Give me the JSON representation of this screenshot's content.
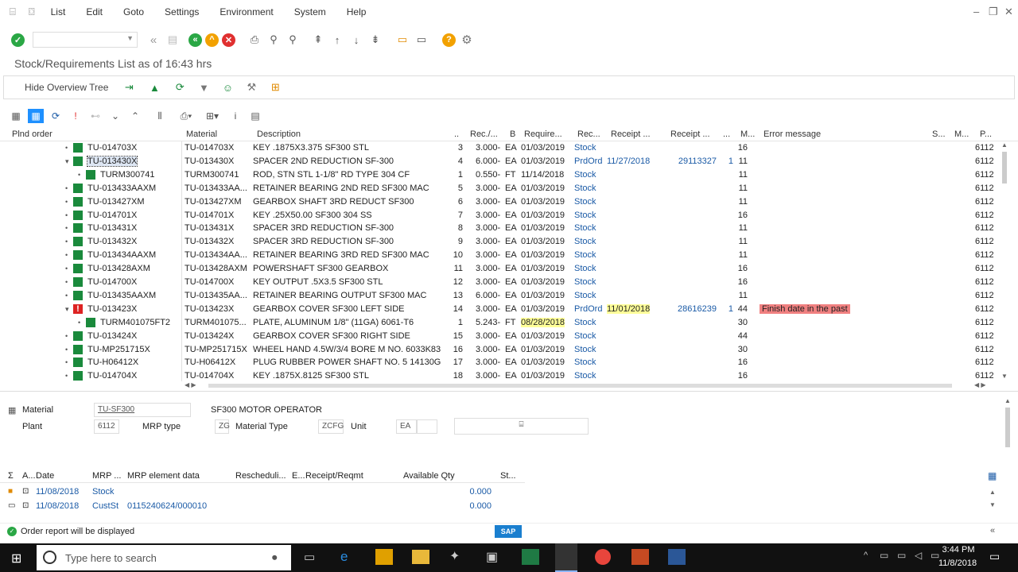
{
  "menu": [
    "List",
    "Edit",
    "Goto",
    "Settings",
    "Environment",
    "System",
    "Help"
  ],
  "title": "Stock/Requirements List as of 16:43 hrs",
  "app_toolbar": {
    "hide_tree": "Hide Overview Tree"
  },
  "columns": {
    "plnd": "Plnd order",
    "material": "Material",
    "desc": "Description",
    "dots1": "..",
    "rec": "Rec./...",
    "b": "B",
    "req": "Require...",
    "rec2": "Rec...",
    "receipt1": "Receipt ...",
    "receipt2": "Receipt ...",
    "dots2": "...",
    "m": "M...",
    "err": "Error message",
    "s": "S...",
    "m2": "M...",
    "p": "P..."
  },
  "rows": [
    {
      "tree": "•",
      "icon": "green",
      "plnd": "TU-014703X",
      "mat": "TU-014703X",
      "desc": "KEY .1875X3.375 SF300   STL",
      "n": "3",
      "qty": "3.000-",
      "u": "EA",
      "date": "01/03/2019",
      "rec": "Stock",
      "rdate": "",
      "rnum": "",
      "r1": "",
      "m": "16",
      "err": "",
      "p": "6112"
    },
    {
      "tree": "▾",
      "icon": "green",
      "plnd": "TU-013430X",
      "mat": "TU-013430X",
      "desc": "SPACER 2ND REDUCTION SF-300",
      "n": "4",
      "qty": "6.000-",
      "u": "EA",
      "date": "01/03/2019",
      "rec": "PrdOrd",
      "rdate": "11/27/2018",
      "rnum": "29113327",
      "r1": "1",
      "m": "11",
      "err": "",
      "p": "6112"
    },
    {
      "tree": "•",
      "icon": "green",
      "plnd": "TURM300741",
      "mat": "TURM300741",
      "desc": "ROD, STN STL 1-1/8\" RD TYPE 304 CF",
      "n": "1",
      "qty": "0.550-",
      "u": "FT",
      "date": "11/14/2018",
      "rec": "Stock",
      "rdate": "",
      "rnum": "",
      "r1": "",
      "m": "11",
      "err": "",
      "p": "6112"
    },
    {
      "tree": "•",
      "icon": "green",
      "plnd": "TU-013433AAXM",
      "mat": "TU-013433AA...",
      "desc": "RETAINER BEARING 2ND RED SF300 MAC",
      "n": "5",
      "qty": "3.000-",
      "u": "EA",
      "date": "01/03/2019",
      "rec": "Stock",
      "rdate": "",
      "rnum": "",
      "r1": "",
      "m": "11",
      "err": "",
      "p": "6112"
    },
    {
      "tree": "•",
      "icon": "green",
      "plnd": "TU-013427XM",
      "mat": "TU-013427XM",
      "desc": "GEARBOX SHAFT 3RD REDUCT SF300",
      "n": "6",
      "qty": "3.000-",
      "u": "EA",
      "date": "01/03/2019",
      "rec": "Stock",
      "rdate": "",
      "rnum": "",
      "r1": "",
      "m": "11",
      "err": "",
      "p": "6112"
    },
    {
      "tree": "•",
      "icon": "green",
      "plnd": "TU-014701X",
      "mat": "TU-014701X",
      "desc": "KEY .25X50.00 SF300 304 SS",
      "n": "7",
      "qty": "3.000-",
      "u": "EA",
      "date": "01/03/2019",
      "rec": "Stock",
      "rdate": "",
      "rnum": "",
      "r1": "",
      "m": "16",
      "err": "",
      "p": "6112"
    },
    {
      "tree": "•",
      "icon": "green",
      "plnd": "TU-013431X",
      "mat": "TU-013431X",
      "desc": "SPACER 3RD REDUCTION SF-300",
      "n": "8",
      "qty": "3.000-",
      "u": "EA",
      "date": "01/03/2019",
      "rec": "Stock",
      "rdate": "",
      "rnum": "",
      "r1": "",
      "m": "11",
      "err": "",
      "p": "6112"
    },
    {
      "tree": "•",
      "icon": "green",
      "plnd": "TU-013432X",
      "mat": "TU-013432X",
      "desc": "SPACER  3RD REDUCTION SF-300",
      "n": "9",
      "qty": "3.000-",
      "u": "EA",
      "date": "01/03/2019",
      "rec": "Stock",
      "rdate": "",
      "rnum": "",
      "r1": "",
      "m": "11",
      "err": "",
      "p": "6112"
    },
    {
      "tree": "•",
      "icon": "green",
      "plnd": "TU-013434AAXM",
      "mat": "TU-013434AA...",
      "desc": "RETAINER BEARING 3RD RED SF300 MAC",
      "n": "10",
      "qty": "3.000-",
      "u": "EA",
      "date": "01/03/2019",
      "rec": "Stock",
      "rdate": "",
      "rnum": "",
      "r1": "",
      "m": "11",
      "err": "",
      "p": "6112"
    },
    {
      "tree": "•",
      "icon": "green",
      "plnd": "TU-013428AXM",
      "mat": "TU-013428AXM",
      "desc": "POWERSHAFT SF300 GEARBOX",
      "n": "11",
      "qty": "3.000-",
      "u": "EA",
      "date": "01/03/2019",
      "rec": "Stock",
      "rdate": "",
      "rnum": "",
      "r1": "",
      "m": "16",
      "err": "",
      "p": "6112"
    },
    {
      "tree": "•",
      "icon": "green",
      "plnd": "TU-014700X",
      "mat": "TU-014700X",
      "desc": "KEY OUTPUT .5X3.5 SF300  STL",
      "n": "12",
      "qty": "3.000-",
      "u": "EA",
      "date": "01/03/2019",
      "rec": "Stock",
      "rdate": "",
      "rnum": "",
      "r1": "",
      "m": "16",
      "err": "",
      "p": "6112"
    },
    {
      "tree": "•",
      "icon": "green",
      "plnd": "TU-013435AAXM",
      "mat": "TU-013435AA...",
      "desc": "RETAINER BEARING OUTPUT SF300 MAC",
      "n": "13",
      "qty": "6.000-",
      "u": "EA",
      "date": "01/03/2019",
      "rec": "Stock",
      "rdate": "",
      "rnum": "",
      "r1": "",
      "m": "11",
      "err": "",
      "p": "6112"
    },
    {
      "tree": "▾",
      "icon": "red",
      "plnd": "TU-013423X",
      "mat": "TU-013423X",
      "desc": "GEARBOX COVER SF300 LEFT SIDE",
      "n": "14",
      "qty": "3.000-",
      "u": "EA",
      "date": "01/03/2019",
      "rec": "PrdOrd",
      "rdate": "11/01/2018",
      "rnum": "28616239",
      "r1": "1",
      "m": "44",
      "err": "Finish date in the past",
      "p": "6112"
    },
    {
      "tree": "•",
      "icon": "green",
      "plnd": "TURM401075FT2",
      "mat": "TURM401075...",
      "desc": "PLATE, ALUMINUM 1/8\" (11GA) 6061-T6",
      "n": "1",
      "qty": "5.243-",
      "u": "FT",
      "date": "08/28/2018",
      "rec": "Stock",
      "rdate": "",
      "rnum": "",
      "r1": "",
      "m": "30",
      "err": "",
      "p": "6112"
    },
    {
      "tree": "•",
      "icon": "green",
      "plnd": "TU-013424X",
      "mat": "TU-013424X",
      "desc": "GEARBOX COVER SF300 RIGHT SIDE",
      "n": "15",
      "qty": "3.000-",
      "u": "EA",
      "date": "01/03/2019",
      "rec": "Stock",
      "rdate": "",
      "rnum": "",
      "r1": "",
      "m": "44",
      "err": "",
      "p": "6112"
    },
    {
      "tree": "•",
      "icon": "green",
      "plnd": "TU-MP251715X",
      "mat": "TU-MP251715X",
      "desc": "WHEEL HAND 4.5W/3/4 BORE M NO. 6033K83",
      "n": "16",
      "qty": "3.000-",
      "u": "EA",
      "date": "01/03/2019",
      "rec": "Stock",
      "rdate": "",
      "rnum": "",
      "r1": "",
      "m": "30",
      "err": "",
      "p": "6112"
    },
    {
      "tree": "•",
      "icon": "green",
      "plnd": "TU-H06412X",
      "mat": "TU-H06412X",
      "desc": "PLUG RUBBER POWER SHAFT  NO. 5 14130G",
      "n": "17",
      "qty": "3.000-",
      "u": "EA",
      "date": "01/03/2019",
      "rec": "Stock",
      "rdate": "",
      "rnum": "",
      "r1": "",
      "m": "16",
      "err": "",
      "p": "6112"
    },
    {
      "tree": "•",
      "icon": "green",
      "plnd": "TU-014704X",
      "mat": "TU-014704X",
      "desc": "KEY .1875X.8125 SF300   STL",
      "n": "18",
      "qty": "3.000-",
      "u": "EA",
      "date": "01/03/2019",
      "rec": "Stock",
      "rdate": "",
      "rnum": "",
      "r1": "",
      "m": "16",
      "err": "",
      "p": "6112"
    }
  ],
  "detail": {
    "material_label": "Material",
    "material_value": "TU-SF300",
    "material_desc": "SF300 MOTOR OPERATOR",
    "plant_label": "Plant",
    "plant_value": "6112",
    "mrp_type_label": "MRP type",
    "mrp_type_value": "ZG",
    "mat_type_label": "Material Type",
    "mat_type_value": "ZCFG",
    "unit_label": "Unit",
    "unit_value": "EA"
  },
  "lower_columns": {
    "a": "A...",
    "date": "Date",
    "mrp": "MRP ...",
    "mrp_data": "MRP element data",
    "resched": "Rescheduli...",
    "e": "E...",
    "receipt": "Receipt/Reqmt",
    "avail": "Available Qty",
    "st": "St..."
  },
  "lower_rows": [
    {
      "date": "11/08/2018",
      "mrp": "Stock",
      "data": "",
      "avail": "0.000"
    },
    {
      "date": "11/08/2018",
      "mrp": "CustSt",
      "data": "0115240624/000010",
      "avail": "0.000"
    }
  ],
  "status": "Order report will be displayed",
  "taskbar": {
    "search": "Type here to search",
    "time": "3:44 PM",
    "date": "11/8/2018"
  }
}
